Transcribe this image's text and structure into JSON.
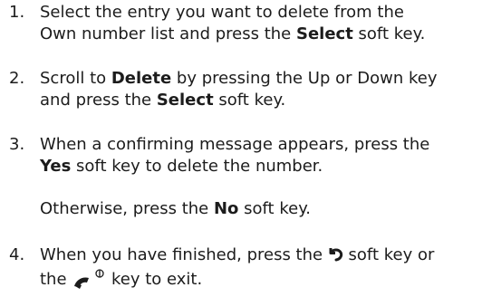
{
  "steps": [
    {
      "num": "1.",
      "l1": "Select the entry you want to delete from the",
      "l2a": "Own number list and press the ",
      "l2b": "Select",
      "l2c": " soft key."
    },
    {
      "num": "2.",
      "l1a": "Scroll to ",
      "l1b": "Delete",
      "l1c": " by pressing the Up or Down key",
      "l2a": "and press the ",
      "l2b": "Select",
      "l2c": " soft key."
    },
    {
      "num": "3.",
      "l1": "When a confirming message appears, press the",
      "l2a": "Yes",
      "l2b": " soft key to delete the number."
    },
    {
      "num": "4.",
      "l1a": "When you have finished, press the ",
      "l1b": " soft key or",
      "l2a": "the ",
      "l2b": " key to exit."
    }
  ],
  "note": {
    "a": "Otherwise, press the ",
    "b": "No",
    "c": " soft key."
  },
  "icons": {
    "back": "back-arrow-icon",
    "end": "end-power-key-icon"
  }
}
